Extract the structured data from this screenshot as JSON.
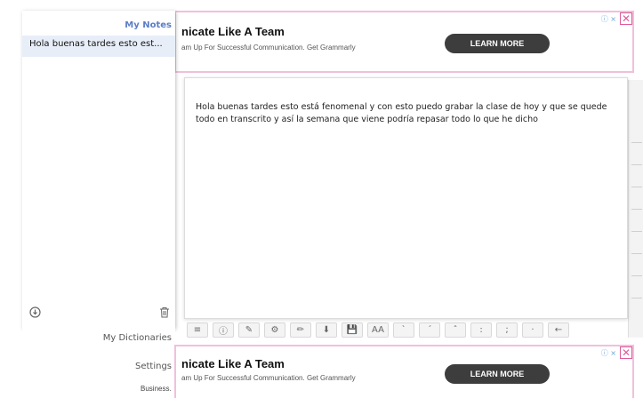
{
  "ads": {
    "top": {
      "title": "nicate Like A Team",
      "subtitle": "am Up For Successful Communication. Get Grammarly",
      "button": "LEARN MORE"
    },
    "bottom": {
      "title": "nicate Like A Team",
      "subtitle": "am Up For Successful Communication. Get Grammarly",
      "partial_text": "Business.",
      "button": "LEARN MORE"
    },
    "choices_icon": "ⓘ ×",
    "close_icon": "✕"
  },
  "sidebar": {
    "title": "My Notes",
    "notes": [
      "Hola buenas tardes esto est..."
    ]
  },
  "menu": {
    "dictionaries": "My Dictionaries",
    "settings": "Settings"
  },
  "editor": {
    "content": "Hola buenas tardes esto está fenomenal y con esto puedo grabar la clase de hoy y que se quede todo en transcrito y así la semana que viene podría repasar todo lo que he dicho"
  },
  "toolbar": {
    "buttons": [
      "≡",
      "ⓘ",
      "✎",
      "⚙",
      "✏",
      "⬇",
      "💾",
      "AA",
      "ˋ",
      "ˊ",
      "ˆ",
      ":",
      ";",
      "·",
      "←"
    ]
  },
  "icons": {
    "download": "download-icon",
    "trash": "trash-icon"
  }
}
